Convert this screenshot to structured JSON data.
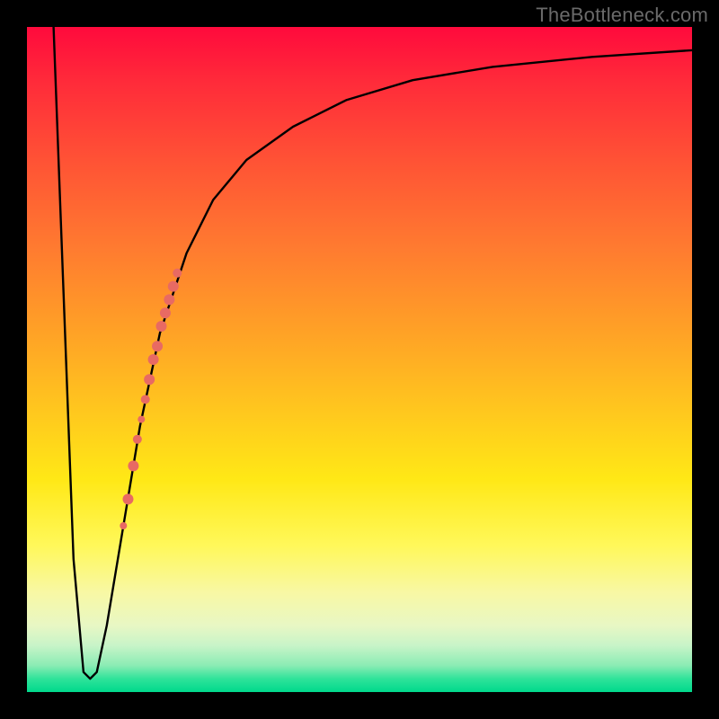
{
  "watermark": "TheBottleneck.com",
  "chart_data": {
    "type": "line",
    "title": "",
    "xlabel": "",
    "ylabel": "",
    "xlim": [
      0,
      100
    ],
    "ylim": [
      0,
      100
    ],
    "background_gradient": {
      "top": "#ff0a3c",
      "bottom": "#00d98c"
    },
    "series": [
      {
        "name": "bottleneck-curve",
        "stroke": "#000000",
        "x": [
          4.0,
          5.5,
          7.0,
          8.5,
          9.5,
          10.5,
          12.0,
          14.0,
          17.0,
          20.0,
          24.0,
          28.0,
          33.0,
          40.0,
          48.0,
          58.0,
          70.0,
          85.0,
          100.0
        ],
        "y": [
          100,
          60,
          20,
          3,
          2,
          3,
          10,
          22,
          40,
          54,
          66,
          74,
          80,
          85,
          89,
          92,
          94,
          95.5,
          96.5
        ]
      }
    ],
    "markers": {
      "name": "highlighted-range",
      "shape": "circle",
      "fill": "#e86a63",
      "points": [
        {
          "x": 14.5,
          "y": 25,
          "r": 4
        },
        {
          "x": 15.2,
          "y": 29,
          "r": 6
        },
        {
          "x": 16.0,
          "y": 34,
          "r": 6
        },
        {
          "x": 16.6,
          "y": 38,
          "r": 5
        },
        {
          "x": 17.2,
          "y": 41,
          "r": 4
        },
        {
          "x": 17.8,
          "y": 44,
          "r": 5
        },
        {
          "x": 18.4,
          "y": 47,
          "r": 6
        },
        {
          "x": 19.0,
          "y": 50,
          "r": 6
        },
        {
          "x": 19.6,
          "y": 52,
          "r": 6
        },
        {
          "x": 20.2,
          "y": 55,
          "r": 6
        },
        {
          "x": 20.8,
          "y": 57,
          "r": 6
        },
        {
          "x": 21.4,
          "y": 59,
          "r": 6
        },
        {
          "x": 22.0,
          "y": 61,
          "r": 6
        },
        {
          "x": 22.6,
          "y": 63,
          "r": 5
        }
      ]
    }
  }
}
